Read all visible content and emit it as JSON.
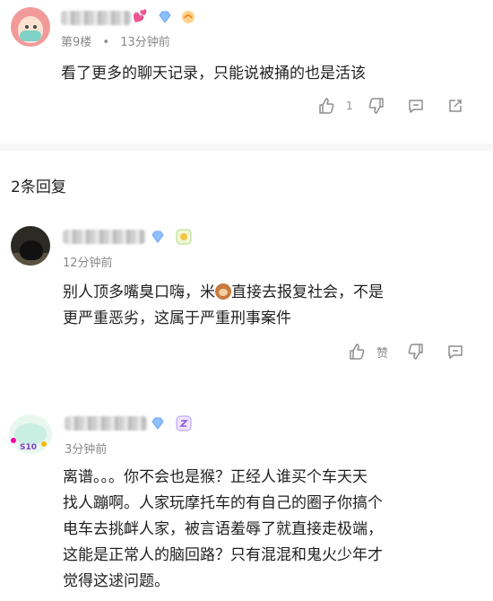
{
  "comment1": {
    "floor": "第9楼",
    "dot": "•",
    "time": "13分钟前",
    "text": "看了更多的聊天记录，只能说被捅的也是活该",
    "like_count": "1"
  },
  "replies_header": "2条回复",
  "reply1": {
    "time": "12分钟前",
    "text_before_emoji": "别人顶多嘴臭口嗨，米",
    "emoji": "monkey-emoji",
    "text_after_emoji": "直接去报复社会，不是\n更严重恶劣，这属于严重刑事案件",
    "like_label": "赞"
  },
  "reply2": {
    "avatar_badge": "S10",
    "time": "3分钟前",
    "text": "离谱。。。你不会也是猴？正经人谁买个车天天\n找人蹦啊。人家玩摩托车的有自己的圈子你搞个\n电车去挑衅人家，被言语羞辱了就直接走极端，\n这能是正常人的脑回路？只有混混和鬼火少年才\n觉得这逑问题。"
  },
  "colors": {
    "meta_gray": "#8a8a8a",
    "icon_gray": "#8d8d8d",
    "diamond_blue": "#7fb3ff",
    "heart_pink": "#ff4fa3"
  }
}
